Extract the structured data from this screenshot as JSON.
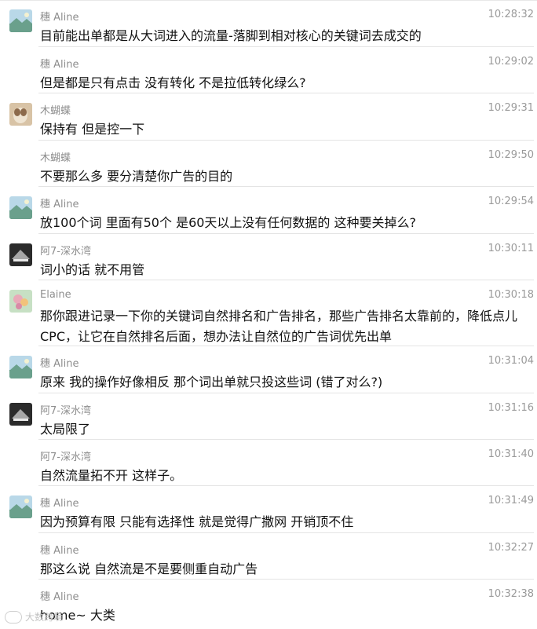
{
  "messages": [
    {
      "sender": "穗 Aline",
      "time": "10:28:32",
      "text": "目前能出单都是从大词进入的流量-落脚到相对核心的关键词去成交的",
      "avatar": "landscape"
    },
    {
      "sender": "穗 Aline",
      "time": "10:29:02",
      "text": "但是都是只有点击 没有转化 不是拉低转化绿么?",
      "avatar": ""
    },
    {
      "sender": "木蝴蝶",
      "time": "10:29:31",
      "text": "保持有 但是控一下",
      "avatar": "butterfly"
    },
    {
      "sender": "木蝴蝶",
      "time": "10:29:50",
      "text": "不要那么多 要分清楚你广告的目的",
      "avatar": ""
    },
    {
      "sender": "穗 Aline",
      "time": "10:29:54",
      "text": "放100个词 里面有50个 是60天以上没有任何数据的 这种要关掉么?",
      "avatar": "landscape"
    },
    {
      "sender": "阿7-深水湾",
      "time": "10:30:11",
      "text": "词小的话 就不用管",
      "avatar": "dark"
    },
    {
      "sender": "Elaine",
      "time": "10:30:18",
      "text": "那你跟进记录一下你的关键词自然排名和广告排名，那些广告排名太靠前的，降低点儿CPC，让它在自然排名后面，想办法让自然位的广告词优先出单",
      "avatar": "flower"
    },
    {
      "sender": "穗 Aline",
      "time": "10:31:04",
      "text": "原来 我的操作好像相反 那个词出单就只投这些词 (错了对么?)",
      "avatar": "landscape"
    },
    {
      "sender": "阿7-深水湾",
      "time": "10:31:16",
      "text": "太局限了",
      "avatar": "dark"
    },
    {
      "sender": "阿7-深水湾",
      "time": "10:31:40",
      "text": "自然流量拓不开 这样子。",
      "avatar": ""
    },
    {
      "sender": "穗 Aline",
      "time": "10:31:49",
      "text": "因为预算有限 只能有选择性 就是觉得广撒网 开销顶不住",
      "avatar": "landscape"
    },
    {
      "sender": "穗 Aline",
      "time": "10:32:27",
      "text": "那这么说 自然流是不是要侧重自动广告",
      "avatar": ""
    },
    {
      "sender": "穗 Aline",
      "time": "10:32:38",
      "text": "home~ 大类",
      "avatar": ""
    }
  ],
  "watermark": "大数跨境"
}
